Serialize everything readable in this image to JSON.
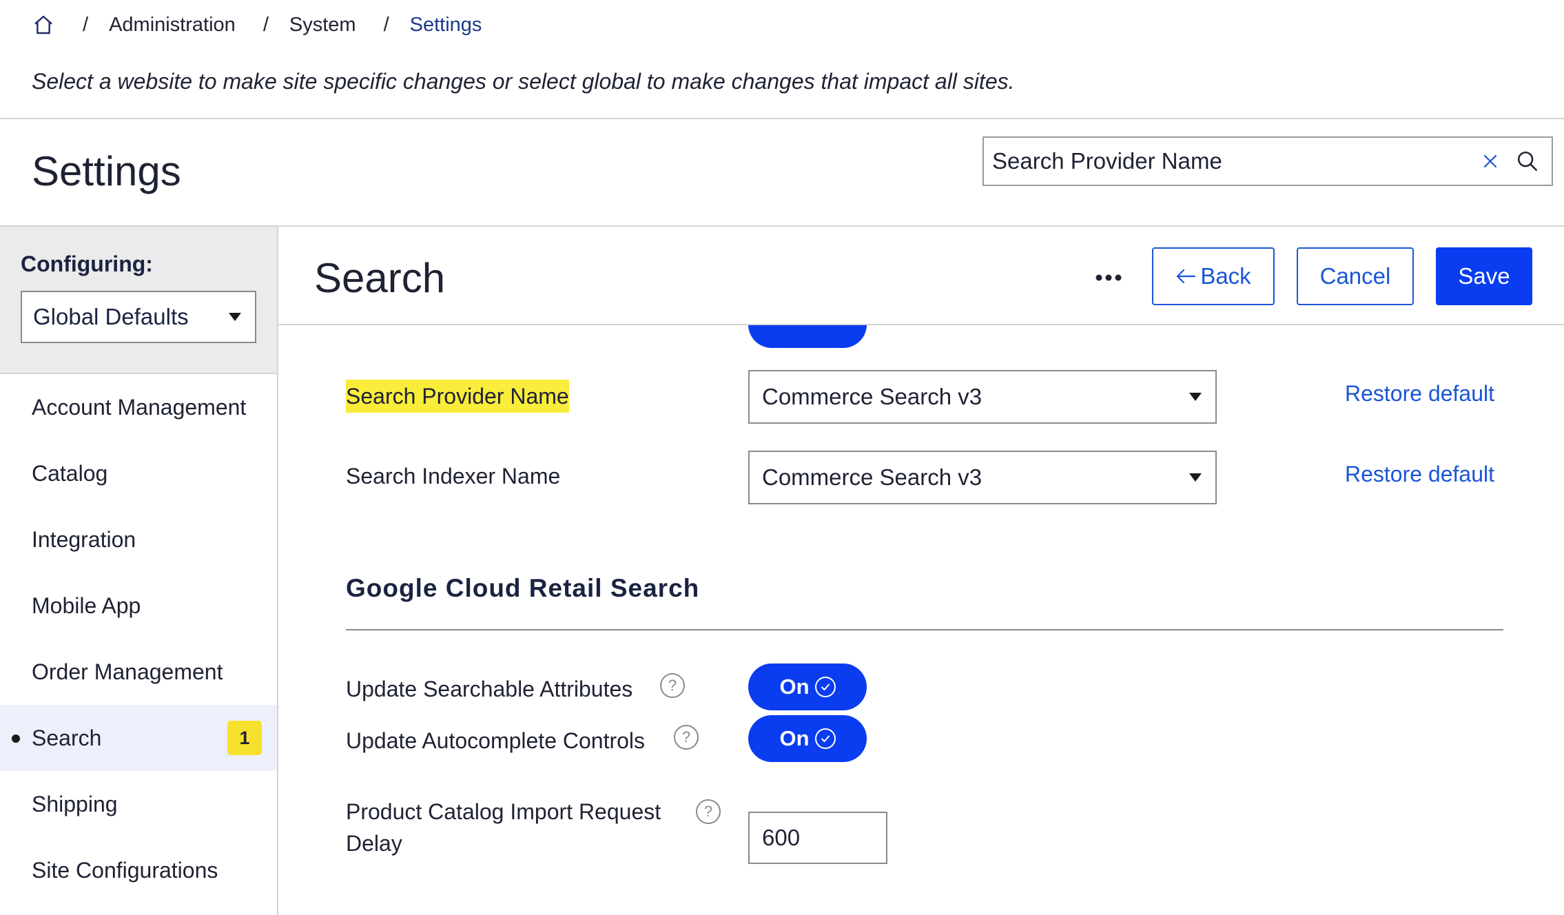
{
  "breadcrumb": {
    "home_icon": "home-icon",
    "items": [
      "Administration",
      "System",
      "Settings"
    ],
    "separator": "/"
  },
  "subtitle": "Select a website to make site specific changes or select global to make changes that impact all sites.",
  "header": {
    "title": "Settings",
    "search": {
      "value": "Search Provider Name",
      "clear_icon": "close-icon",
      "search_icon": "search-icon"
    }
  },
  "sidebar": {
    "configuring_label": "Configuring:",
    "config_select": "Global Defaults",
    "items": [
      {
        "label": "Account Management"
      },
      {
        "label": "Catalog"
      },
      {
        "label": "Integration"
      },
      {
        "label": "Mobile App"
      },
      {
        "label": "Order Management"
      },
      {
        "label": "Search",
        "active": true,
        "badge": "1"
      },
      {
        "label": "Shipping"
      },
      {
        "label": "Site Configurations"
      }
    ]
  },
  "main": {
    "title": "Search",
    "more_icon": "more-horizontal-icon",
    "buttons": {
      "back": "Back",
      "cancel": "Cancel",
      "save": "Save"
    },
    "fields": {
      "provider": {
        "label": "Search Provider Name",
        "value": "Commerce Search v3",
        "restore": "Restore default"
      },
      "indexer": {
        "label": "Search Indexer Name",
        "value": "Commerce Search v3",
        "restore": "Restore default"
      }
    },
    "section_title": "Google Cloud Retail Search",
    "toggles": [
      {
        "label": "Update Searchable Attributes",
        "state": "On"
      },
      {
        "label": "Update Autocomplete Controls",
        "state": "On"
      }
    ],
    "delay": {
      "label": "Product Catalog Import Request Delay",
      "value": "600"
    }
  },
  "colors": {
    "accent": "#0a3df0",
    "link": "#1a55d6",
    "highlight": "#f9ec3a",
    "badge": "#f5e12e"
  }
}
